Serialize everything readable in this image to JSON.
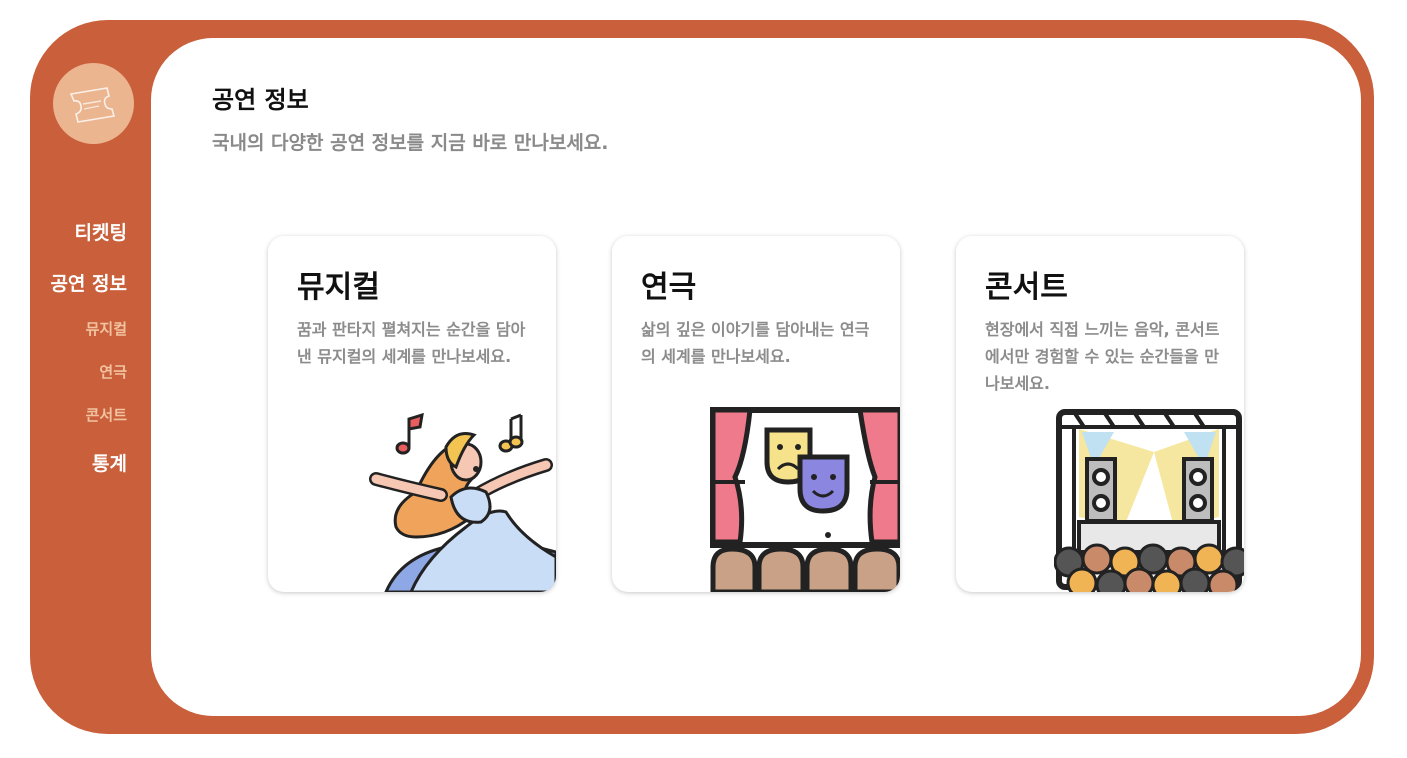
{
  "sidebar": {
    "logo_icon": "ticket-icon",
    "nav": [
      {
        "label": "티켓팅"
      },
      {
        "label": "공연 정보"
      }
    ],
    "subnav": [
      {
        "label": "뮤지컬"
      },
      {
        "label": "연극"
      },
      {
        "label": "콘서트"
      }
    ],
    "stats_label": "통계"
  },
  "main": {
    "title": "공연 정보",
    "subtitle": "국내의 다양한 공연 정보를 지금 바로 만나보세요."
  },
  "cards": [
    {
      "title": "뮤지컬",
      "desc": "꿈과 판타지 펼쳐지는 순간을 담아낸 뮤지컬의 세계를 만나보세요.",
      "icon": "singer-icon"
    },
    {
      "title": "연극",
      "desc": "삶의 깊은 이야기를 담아내는 연극의 세계를 만나보세요.",
      "icon": "theater-stage-icon"
    },
    {
      "title": "콘서트",
      "desc": "현장에서 직접 느끼는 음악, 콘서트에서만 경험할 수 있는 순간들을 만나보세요.",
      "icon": "concert-stage-icon"
    }
  ],
  "colors": {
    "accent": "#c95f3b",
    "logo_bg": "#ebb58f",
    "subnav_text": "#f2c39f",
    "muted_text": "#8a8a8a"
  }
}
